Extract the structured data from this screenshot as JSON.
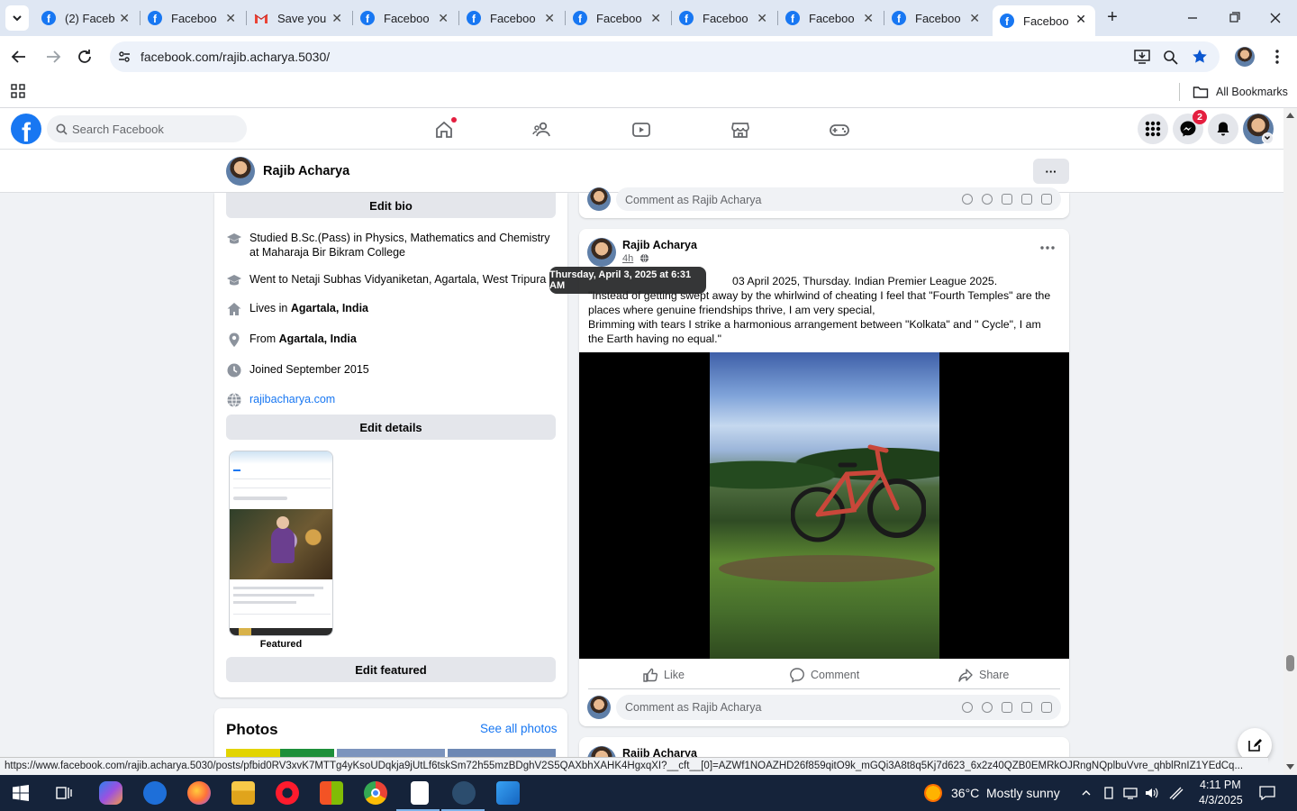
{
  "browser": {
    "tabs": [
      {
        "title": "(2) Faceb",
        "icon": "facebook-favicon"
      },
      {
        "title": "Faceboo",
        "icon": "facebook-favicon"
      },
      {
        "title": "Save you",
        "icon": "gmail-favicon"
      },
      {
        "title": "Faceboo",
        "icon": "facebook-favicon"
      },
      {
        "title": "Faceboo",
        "icon": "facebook-favicon"
      },
      {
        "title": "Faceboo",
        "icon": "facebook-favicon"
      },
      {
        "title": "Faceboo",
        "icon": "facebook-favicon"
      },
      {
        "title": "Faceboo",
        "icon": "facebook-favicon"
      },
      {
        "title": "Faceboo",
        "icon": "facebook-favicon"
      },
      {
        "title": "Faceboo",
        "icon": "facebook-favicon",
        "active": true
      }
    ],
    "url": "facebook.com/rajib.acharya.5030/",
    "bookmarks_label": "All Bookmarks",
    "status_url": "https://www.facebook.com/rajib.acharya.5030/posts/pfbid0RV3xvK7MTTg4yKsoUDqkja9jUtLf6tskSm72h55mzBDghV2S5QAXbhXAHK4HgxqXI?__cft__[0]=AZWf1NOAZHD26f859qitO9k_mGQi3A8t8q5Kj7d623_6x2z40QZB0EMRkOJRngNQplbuVvre_qhblRnIZ1YEdCq..."
  },
  "fb": {
    "search_placeholder": "Search Facebook",
    "messenger_badge": "2",
    "accent": "#1877f2",
    "badge_color": "#e41e3f"
  },
  "profile": {
    "name": "Rajib Acharya",
    "more_label": "···"
  },
  "intro": {
    "edit_bio": "Edit bio",
    "items": [
      {
        "icon": "education-cap-icon",
        "text": "Studied B.Sc.(Pass) in Physics, Mathematics and Chemistry at Maharaja Bir Bikram College"
      },
      {
        "icon": "education-cap-icon",
        "text": "Went to Netaji Subhas Vidyaniketan, Agartala, West Tripura"
      },
      {
        "icon": "home-icon",
        "prefix": "Lives in ",
        "bold": "Agartala, India"
      },
      {
        "icon": "location-pin-icon",
        "prefix": "From ",
        "bold": "Agartala, India"
      },
      {
        "icon": "clock-icon",
        "text": "Joined September 2015"
      },
      {
        "icon": "globe-icon",
        "link": "rajibacharya.com"
      }
    ],
    "edit_details": "Edit details",
    "featured_label": "Featured",
    "edit_featured": "Edit featured"
  },
  "photos": {
    "title": "Photos",
    "see_all": "See all photos"
  },
  "post_prev": {
    "comment_placeholder": "Comment as Rajib Acharya"
  },
  "post": {
    "author": "Rajib Acharya",
    "time": "4h",
    "tooltip": "Thursday, April 3, 2025 at 6:31 AM",
    "text_line1_tail": "03 April 2025, Thursday. Indian Premier League 2025.",
    "text_line2": "\"Instead of getting swept away by the whirlwind of cheating I feel that \"Fourth Temples\" are the places where genuine friendships thrive, I am very special,",
    "text_line3": "Brimming with tears I strike a harmonious arrangement between \"Kolkata\" and \" Cycle\", I am the Earth having no equal.\"",
    "like": "Like",
    "comment": "Comment",
    "share": "Share",
    "comment_placeholder": "Comment as Rajib Acharya"
  },
  "post_next": {
    "author": "Rajib Acharya"
  },
  "taskbar": {
    "temperature": "36°C",
    "weather": "Mostly sunny",
    "time": "4:11 PM",
    "date": "4/3/2025"
  }
}
